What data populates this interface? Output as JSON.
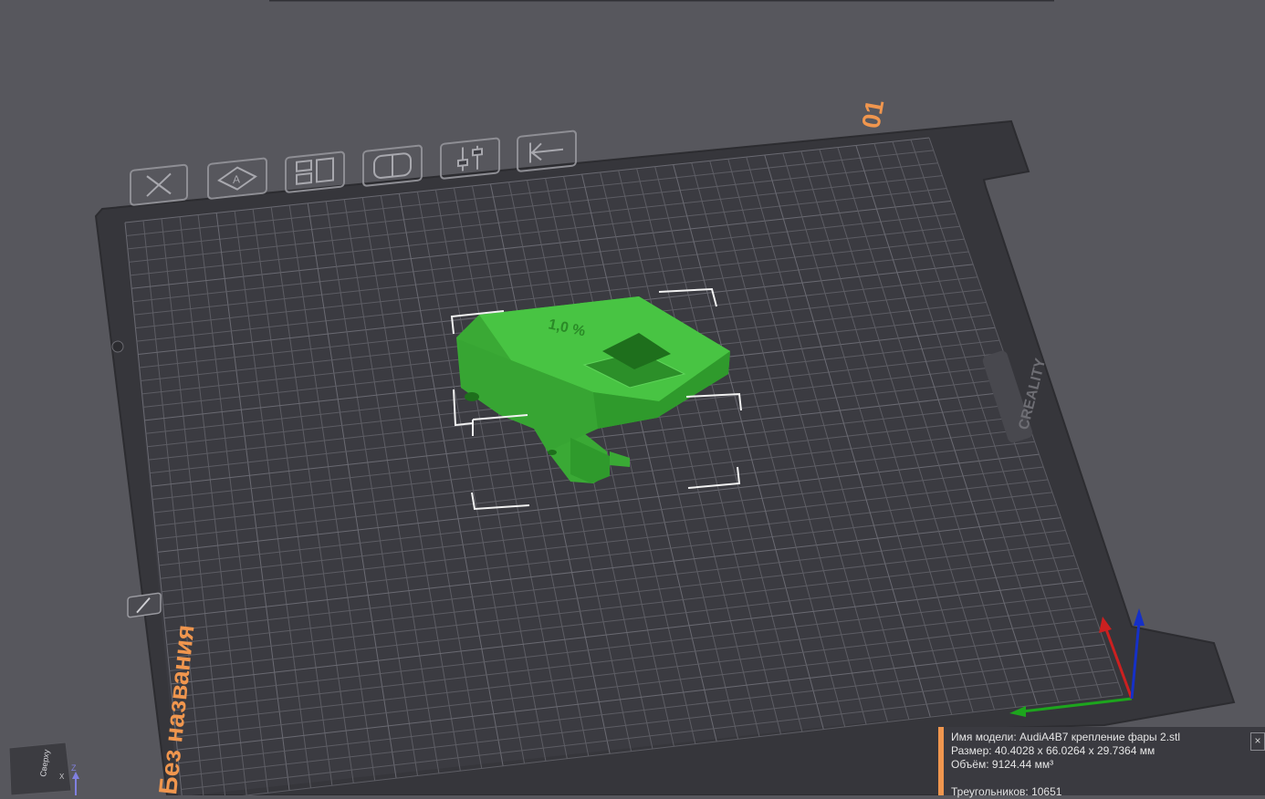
{
  "plate": {
    "number": "01",
    "name": "Без названия",
    "brand": "CREALITY"
  },
  "toolbar": {
    "items": [
      {
        "icon": "close-x-icon",
        "label": "delete"
      },
      {
        "icon": "auto-orient-icon",
        "label": "auto-orient"
      },
      {
        "icon": "arrange-icon",
        "label": "arrange"
      },
      {
        "icon": "add-plate-icon",
        "label": "add-plate"
      },
      {
        "icon": "plate-settings-icon",
        "label": "settings"
      },
      {
        "icon": "pick-bottom-icon",
        "label": "lay-on-face"
      }
    ]
  },
  "model": {
    "color": "#3fb83a",
    "label_text": "1,0 %"
  },
  "info": {
    "name": "Имя модели: AudiA4B7 крепление фары 2.stl",
    "size": "Размер: 40.4028 x 66.0264 x 29.7364 мм",
    "volume": "Объём: 9124.44 мм³",
    "triangles": "Треугольников: 10651",
    "close_label": "×"
  },
  "view_cube": {
    "face_label": "Сверху",
    "axis_z": "Z",
    "axis_x": "X"
  },
  "colors": {
    "background": "#57575d",
    "plate": "#36363b",
    "grid_line": "#5e5e65",
    "accent": "#f0964e",
    "model": "#3fb83a",
    "axis_x": "#cc2020",
    "axis_y": "#1da51d",
    "axis_z": "#1530c8"
  }
}
